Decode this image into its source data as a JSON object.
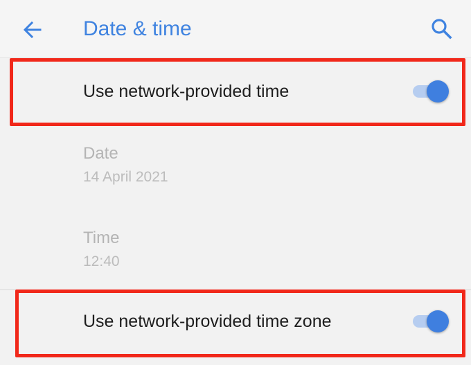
{
  "header": {
    "title": "Date & time",
    "back_icon": "arrow-left-icon",
    "search_icon": "search-icon",
    "accent_color": "#3f83e0"
  },
  "settings": {
    "network_time": {
      "label": "Use network-provided time",
      "enabled": true
    },
    "date": {
      "title": "Date",
      "value": "14 April 2021"
    },
    "time": {
      "title": "Time",
      "value": "12:40"
    },
    "network_time_zone": {
      "label": "Use network-provided time zone",
      "enabled": true
    }
  },
  "highlight_color": "#f1281a"
}
